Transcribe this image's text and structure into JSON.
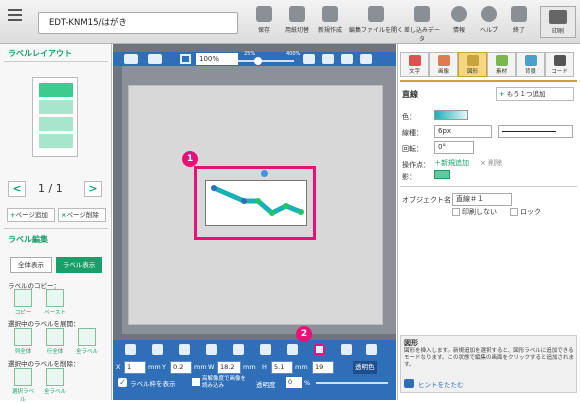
{
  "toolbar": {
    "title_field": "EDT-KNM15/はがき",
    "buttons": [
      {
        "label": "保存",
        "icon": "save-icon"
      },
      {
        "label": "用紙切替",
        "icon": "paper-switch-icon"
      },
      {
        "label": "新規作成",
        "icon": "new-document-icon"
      },
      {
        "label": "編集ファイルを開く",
        "icon": "open-file-icon"
      },
      {
        "label": "差し込みデータ",
        "icon": "merge-data-icon"
      },
      {
        "label": "情報",
        "icon": "info-icon"
      },
      {
        "label": "ヘルプ",
        "icon": "help-icon"
      },
      {
        "label": "終了",
        "icon": "exit-icon"
      }
    ],
    "print_label": "印刷"
  },
  "left_panel": {
    "layout_heading": "ラベルレイアウト",
    "page_indicator": "1 / 1",
    "prev": "<",
    "next": ">",
    "add_page": "ページ追加",
    "delete_page": "ページ削除",
    "label_edit_heading": "ラベル編集",
    "show_all": "全体表示",
    "show_label": "ラベル表示",
    "copy_heading": "ラベルのコピー：",
    "copy": "コピー",
    "paste": "ペースト",
    "expand_heading": "選択中のラベルを展開：",
    "expand_items": [
      "列全体",
      "行全体",
      "全ラベル"
    ],
    "delete_heading": "選択中のラベルを削除：",
    "delete_items": [
      "選択ラベル",
      "全ラベル"
    ]
  },
  "canvas": {
    "zoom_value": "100%",
    "zoom_min": "25%",
    "zoom_max": "400%",
    "zoom_level": 0.35,
    "callout_1": "1",
    "callout_2": "2"
  },
  "bottom": {
    "x_label": "X",
    "x_value": "1",
    "x_unit": "mm",
    "y_label": "Y",
    "y_value": "0.2",
    "y_unit": "mm",
    "w_label": "W",
    "w_value": "18.2",
    "w_unit": "mm",
    "h_label": "H",
    "h_value": "5.1",
    "h_unit": "mm",
    "layer_value": "19",
    "transparent_color": "透明色",
    "show_frame": "ラベル枠を表示",
    "hires": "高解像度で画像を読み込み",
    "transparency_label": "透明度",
    "transparency_value": "0",
    "transparency_unit": "%"
  },
  "right_panel": {
    "tabs": [
      "文字",
      "画像",
      "図形",
      "素材",
      "背景",
      "コード"
    ],
    "section_title": "直線",
    "add_one": "もう１つ追加",
    "color_label": "色：",
    "line_width_label": "線種：",
    "line_width_value": "6px",
    "rotation_label": "回転：",
    "rotation_value": "0°",
    "point_label": "操作点：",
    "new_add": "新規追加",
    "delete": "削除",
    "shadow_label": "影：",
    "object_name_label": "オブジェクト名",
    "object_name_value": "直線＃１",
    "no_print": "印刷しない",
    "lock": "ロック",
    "help_title": "図形",
    "help_text": "図形を挿入します。新規追加を選択すると、図形ラベルに追加できるモードなります。この状態で編集の画面をクリックすると追加されます。",
    "help_fold": "ヒントをたたむ"
  },
  "colors": {
    "accent_green": "#1a9e6a",
    "highlight_pink": "#e6127a",
    "toolbar_blue": "#2f6fb8",
    "line_teal": "#1ab0b8"
  }
}
